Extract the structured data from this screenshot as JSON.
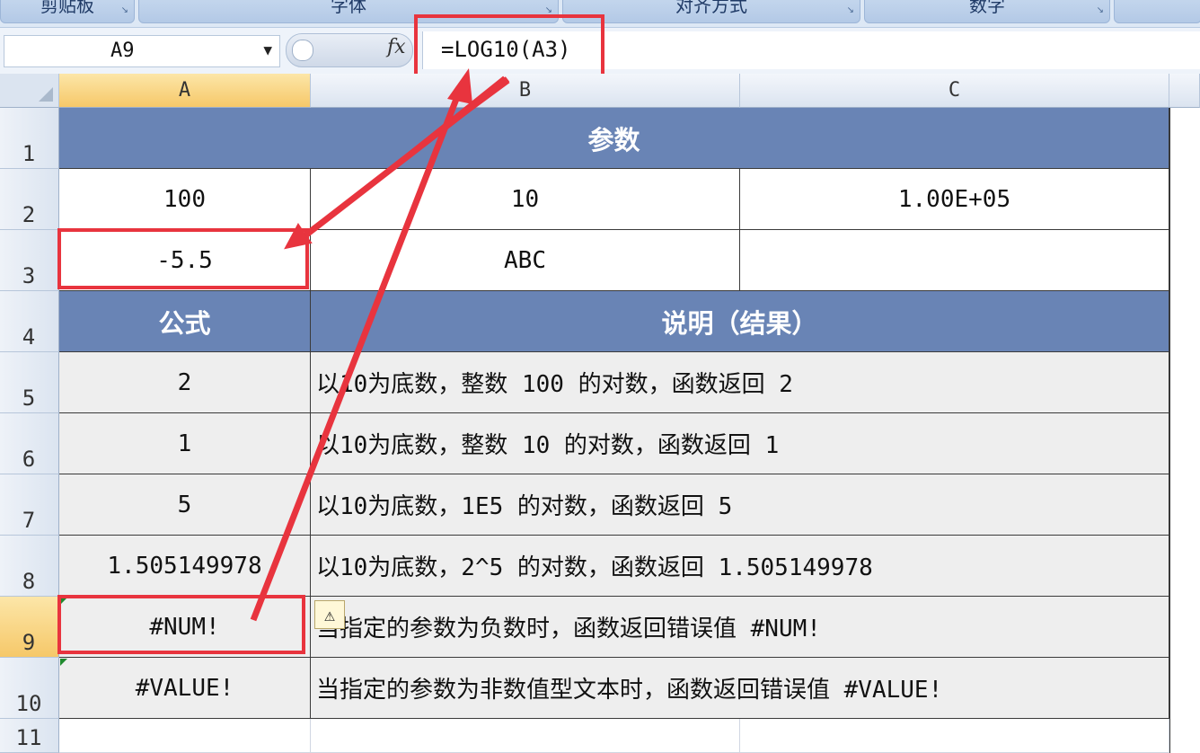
{
  "ribbon": {
    "groups": [
      "剪贴板",
      "字体",
      "对齐方式",
      "数字"
    ]
  },
  "formula_bar": {
    "name_box": "A9",
    "fx_label": "fx",
    "formula": "=LOG10(A3)"
  },
  "columns": [
    "A",
    "B",
    "C"
  ],
  "rows": [
    "1",
    "2",
    "3",
    "4",
    "5",
    "6",
    "7",
    "8",
    "9",
    "10",
    "11"
  ],
  "sheet": {
    "r1_header": "参数",
    "r2": [
      "100",
      "10",
      "1.00E+05"
    ],
    "r3": [
      "-5.5",
      "ABC",
      ""
    ],
    "r4_formula_header": "公式",
    "r4_desc_header": "说明（结果）",
    "results": [
      {
        "value": "2",
        "desc": "以10为底数，整数 100 的对数，函数返回 2"
      },
      {
        "value": "1",
        "desc": "以10为底数，整数 10 的对数，函数返回 1"
      },
      {
        "value": "5",
        "desc": "以10为底数，1E5 的对数，函数返回 5"
      },
      {
        "value": "1.505149978",
        "desc": "以10为底数，2^5 的对数，函数返回 1.505149978"
      },
      {
        "value": "#NUM!",
        "desc": "当指定的参数为负数时，函数返回错误值 #NUM!"
      },
      {
        "value": "#VALUE!",
        "desc": "当指定的参数为非数值型文本时，函数返回错误值 #VALUE!"
      }
    ]
  },
  "colors": {
    "header_fill": "#6984b5",
    "highlight": "#e8343e",
    "selected_header": "#f6c869"
  },
  "icons": [
    "name-box-dropdown-icon",
    "fx-icon",
    "error-warning-icon",
    "select-all-corner-icon"
  ]
}
